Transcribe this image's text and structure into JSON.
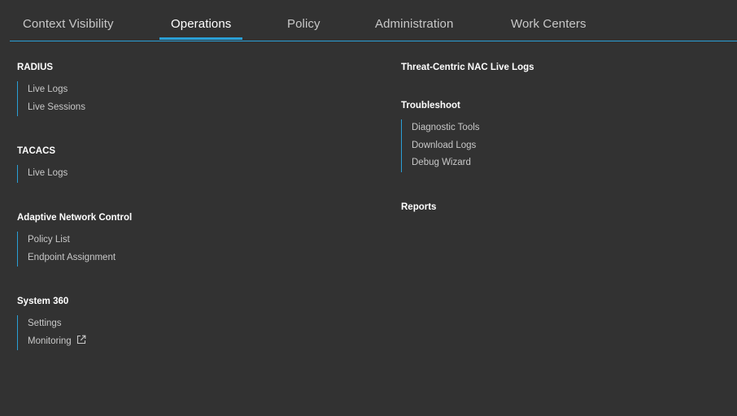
{
  "nav": {
    "tabs": [
      {
        "label": "Context Visibility"
      },
      {
        "label": "Operations"
      },
      {
        "label": "Policy"
      },
      {
        "label": "Administration"
      },
      {
        "label": "Work Centers"
      }
    ],
    "active_tab": "Operations"
  },
  "menu": {
    "left": [
      {
        "title": "RADIUS",
        "items": [
          "Live Logs",
          "Live Sessions"
        ]
      },
      {
        "title": "TACACS",
        "items": [
          "Live Logs"
        ]
      },
      {
        "title": "Adaptive Network Control",
        "items": [
          "Policy List",
          "Endpoint Assignment"
        ]
      },
      {
        "title": "System 360",
        "items": [
          "Settings",
          "Monitoring"
        ]
      }
    ],
    "right": [
      {
        "title": "Threat-Centric NAC Live Logs"
      },
      {
        "title": "Troubleshoot",
        "items": [
          "Diagnostic Tools",
          "Download Logs",
          "Debug Wizard"
        ]
      },
      {
        "title": "Reports"
      }
    ]
  },
  "icons": {
    "external_link": "external-link-icon"
  },
  "colors": {
    "background": "#323232",
    "accent": "#2a9fd6",
    "text": "#c8c8c8",
    "heading": "#ffffff"
  }
}
